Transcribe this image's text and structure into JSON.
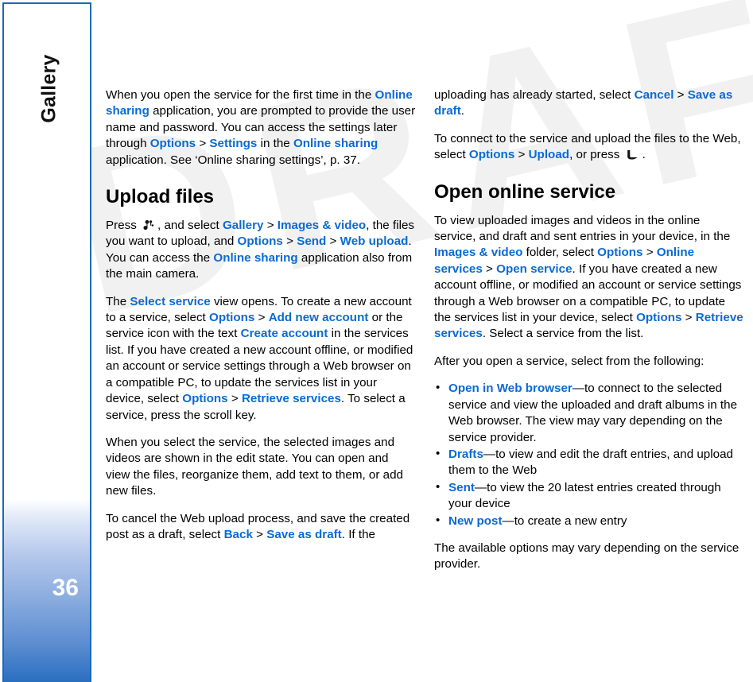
{
  "sidebar": {
    "chapter_title": "Gallery",
    "page_number": "36",
    "accent_color": "#1a69b8"
  },
  "theme": {
    "link_color": "#0b6ad4",
    "text_color": "#000000",
    "watermark_text": "DRAFT",
    "watermark_color": "#f1f1f1"
  },
  "icons": {
    "menu_key": "menu-key-icon",
    "call_key": "call-key-icon"
  },
  "left_column": {
    "p1": {
      "s1": "When you open the service for the first time in the ",
      "l1": "Online sharing",
      "s2": " application, you are prompted to provide the user name and password. You can access the settings later through ",
      "l2": "Options",
      "gt1": " > ",
      "l3": "Settings",
      "s3": " in the ",
      "l4": "Online sharing",
      "s4": " application. See ‘Online sharing settings’, p. 37."
    },
    "heading": "Upload files",
    "p2": {
      "s1": "Press ",
      "s2": ", and select ",
      "l1": "Gallery",
      "gt1": " > ",
      "l2": "Images & video",
      "s3": ", the files you want to upload, and ",
      "l3": "Options",
      "gt2": " > ",
      "l4": "Send",
      "gt3": " > ",
      "l5": "Web upload",
      "s4": ". You can access the ",
      "l6": "Online sharing",
      "s5": " application also from the main camera."
    },
    "p3": {
      "s1": "The ",
      "l1": "Select service",
      "s2": " view opens. To create a new account to a service, select ",
      "l2": "Options",
      "gt1": " > ",
      "l3": "Add new account",
      "s3": " or the service icon with the text ",
      "l4": "Create account",
      "s4": " in the services list. If you have created a new account offline, or modified an account or service settings through a Web browser on a compatible PC, to update the services list in your device, select ",
      "l5": "Options",
      "gt2": " > ",
      "l6": "Retrieve services",
      "s5": ". To select a service, press the scroll key."
    },
    "p4": "When you select the service, the selected images and videos are shown in the edit state. You can open and view the files, reorganize them, add text to them, or add new files.",
    "p5": {
      "s1": "To cancel the Web upload process, and save the created post as a draft, select ",
      "l1": "Back",
      "gt1": " > ",
      "l2": "Save as draft",
      "s2": ". If the"
    }
  },
  "right_column": {
    "p1": {
      "s1": "uploading has already started, select ",
      "l1": "Cancel",
      "gt1": " > ",
      "l2": "Save as draft",
      "s2": "."
    },
    "p2": {
      "s1": "To connect to the service and upload the files to the Web, select ",
      "l1": "Options",
      "gt1": " > ",
      "l2": "Upload",
      "s2": ", or press ",
      "s3": "."
    },
    "heading": "Open online service",
    "p3": {
      "s1": "To view uploaded images and videos in the online service, and draft and sent entries in your device, in the ",
      "l1": "Images & video",
      "s2": " folder, select ",
      "l2": "Options",
      "gt1": " > ",
      "l3": "Online services",
      "gt2": " > ",
      "l4": "Open service",
      "s3": ". If you have created a new account offline, or modified an account or service settings through a Web browser on a compatible PC, to update the services list in your device, select ",
      "l5": "Options",
      "gt3": " > ",
      "l6": "Retrieve services",
      "s4": ". Select a service from the list."
    },
    "p4": "After you open a service, select from the following:",
    "bullets": [
      {
        "link": "Open in Web browser",
        "text": "—to connect to the selected service and view the uploaded and draft albums in the Web browser. The view may vary depending on the service provider."
      },
      {
        "link": "Drafts",
        "text": "—to view and edit the draft entries, and upload them to the Web"
      },
      {
        "link": "Sent",
        "text": "—to view the 20 latest entries created through your device"
      },
      {
        "link": "New post",
        "text": "—to create a new entry"
      }
    ],
    "p5": "The available options may vary depending on the service provider."
  }
}
